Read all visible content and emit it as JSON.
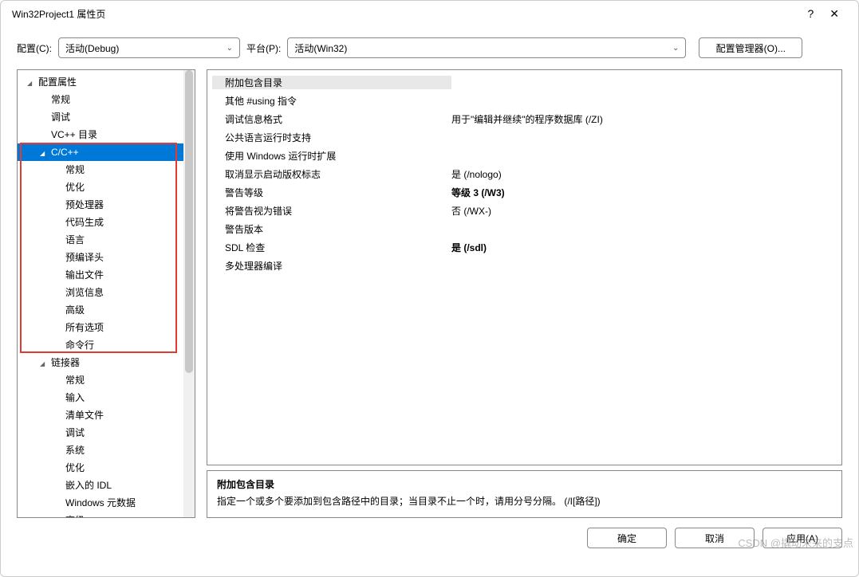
{
  "title": "Win32Project1 属性页",
  "config": {
    "label": "配置(C):",
    "value": "活动(Debug)"
  },
  "platform": {
    "label": "平台(P):",
    "value": "活动(Win32)"
  },
  "config_manager": "配置管理器(O)...",
  "tree": {
    "root": "配置属性",
    "items_top": [
      "常规",
      "调试",
      "VC++ 目录"
    ],
    "cpp_label": "C/C++",
    "cpp_children": [
      "常规",
      "优化",
      "预处理器",
      "代码生成",
      "语言",
      "预编译头",
      "输出文件",
      "浏览信息",
      "高级",
      "所有选项",
      "命令行"
    ],
    "linker_label": "链接器",
    "linker_children": [
      "常规",
      "输入",
      "清单文件",
      "调试",
      "系统",
      "优化",
      "嵌入的 IDL",
      "Windows 元数据",
      "高级"
    ]
  },
  "props": [
    {
      "name": "附加包含目录",
      "val": "",
      "hl": true,
      "bold": false
    },
    {
      "name": "其他 #using 指令",
      "val": "",
      "hl": false,
      "bold": false
    },
    {
      "name": "调试信息格式",
      "val": "用于\"编辑并继续\"的程序数据库 (/ZI)",
      "hl": false,
      "bold": false
    },
    {
      "name": "公共语言运行时支持",
      "val": "",
      "hl": false,
      "bold": false
    },
    {
      "name": "使用 Windows 运行时扩展",
      "val": "",
      "hl": false,
      "bold": false
    },
    {
      "name": "取消显示启动版权标志",
      "val": "是 (/nologo)",
      "hl": false,
      "bold": false
    },
    {
      "name": "警告等级",
      "val": "等级 3 (/W3)",
      "hl": false,
      "bold": true
    },
    {
      "name": "将警告视为错误",
      "val": "否 (/WX-)",
      "hl": false,
      "bold": false
    },
    {
      "name": "警告版本",
      "val": "",
      "hl": false,
      "bold": false
    },
    {
      "name": "SDL 检查",
      "val": "是 (/sdl)",
      "hl": false,
      "bold": true
    },
    {
      "name": "多处理器编译",
      "val": "",
      "hl": false,
      "bold": false
    }
  ],
  "description": {
    "title": "附加包含目录",
    "text": "指定一个或多个要添加到包含路径中的目录；当目录不止一个时，请用分号分隔。    (/I[路径])"
  },
  "buttons": {
    "ok": "确定",
    "cancel": "取消",
    "apply": "应用(A)"
  },
  "watermark": "CSDN @撬动未来的支点"
}
